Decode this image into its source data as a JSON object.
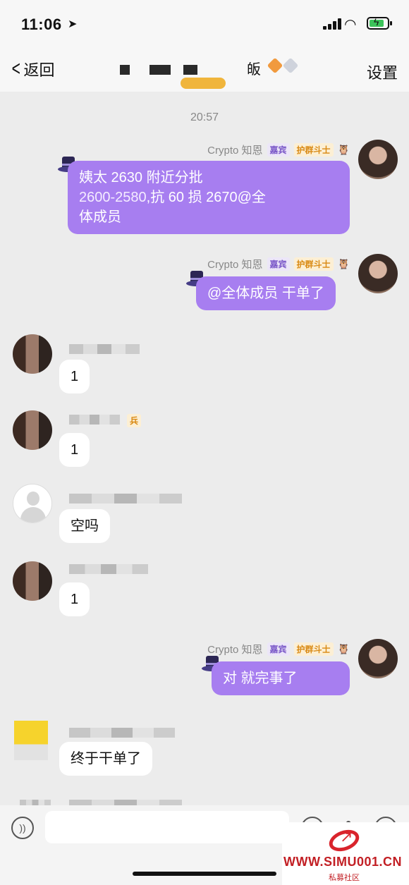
{
  "status_bar": {
    "time": "11:06",
    "location_icon": "location-arrow-icon"
  },
  "nav": {
    "back_label": "返回",
    "title_visible_char": "皈",
    "settings_label": "设置"
  },
  "chat": {
    "timestamp": "20:57",
    "self_sender": {
      "name": "Crypto 知恩",
      "badge_guest": "嘉宾",
      "badge_guard": "护群斗士"
    },
    "messages": [
      {
        "from": "me",
        "line1": "姨太 2630 附近分批",
        "line2_hl": "2600-2580",
        "line2_rest": ",抗 60 损 2670@全",
        "line3": "体成员"
      },
      {
        "from": "me",
        "text": "@全体成员 干单了"
      },
      {
        "from": "other",
        "text": "1"
      },
      {
        "from": "other",
        "text": "1"
      },
      {
        "from": "other",
        "text": "空吗"
      },
      {
        "from": "other",
        "text": "1"
      },
      {
        "from": "me",
        "text": "对 就完事了"
      },
      {
        "from": "other",
        "text": "终于干单了"
      }
    ],
    "other_badge_text": "兵"
  },
  "input_bar": {
    "placeholder": ""
  },
  "watermark": {
    "url": "WWW.SIMU001.CN",
    "caption": "私募社区"
  }
}
